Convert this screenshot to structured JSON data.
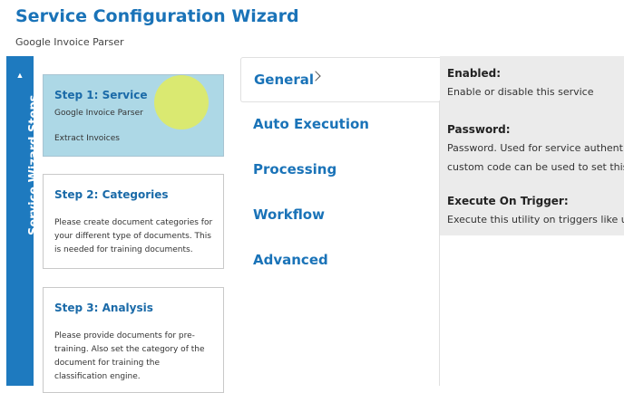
{
  "header": {
    "title": "Service Configuration Wizard",
    "subtitle": "Google Invoice Parser"
  },
  "rail": {
    "label": "Service Wizard Steps",
    "toggle_glyph": "▲"
  },
  "steps": [
    {
      "title": "Step 1: Service",
      "lines": [
        "Google Invoice Parser",
        "Extract Invoices"
      ],
      "active": true
    },
    {
      "title": "Step 2: Categories",
      "text": "Please create document categories for your different type of documents. This is needed for training documents."
    },
    {
      "title": "Step 3: Analysis",
      "text": "Please provide documents for pre-training. Also set the category of the document for training the classification engine."
    }
  ],
  "tabs": [
    {
      "label": "General",
      "active": true
    },
    {
      "label": "Auto Execution"
    },
    {
      "label": "Processing"
    },
    {
      "label": "Workflow"
    },
    {
      "label": "Advanced"
    }
  ],
  "details": {
    "enabled": {
      "label": "Enabled:",
      "desc": "Enable or disable this service"
    },
    "password": {
      "label": "Password:",
      "desc1": "Password. Used for service authentic",
      "desc2": "custom code can be used to set this"
    },
    "execute": {
      "label": "Execute On Trigger:",
      "desc": "Execute this utility on triggers like up"
    }
  },
  "icons": {
    "tab_chevron": "chevron-right-icon"
  }
}
